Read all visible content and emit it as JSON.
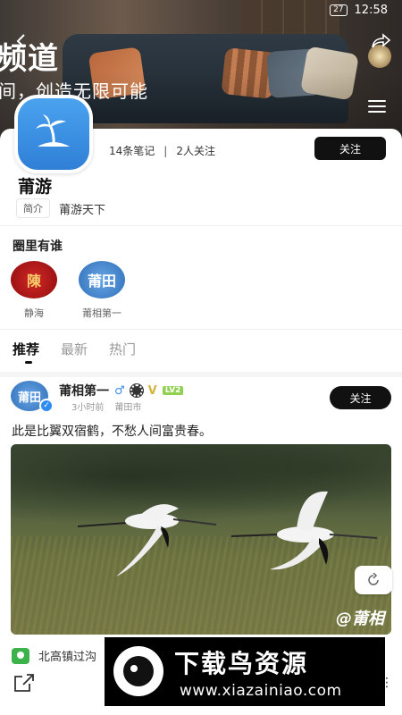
{
  "status_bar": {
    "battery": "27",
    "time": "12:58"
  },
  "banner": {
    "title": "频道",
    "subtitle": "间，创造无限可能"
  },
  "profile": {
    "notes_count": "14条笔记",
    "following_count": "2人关注",
    "follow_label": "关注",
    "name": "莆游",
    "intro_tag": "简介",
    "intro_text": "莆游天下"
  },
  "circle": {
    "title": "圈里有谁",
    "members": [
      {
        "name": "静海",
        "avatar_text": "陳"
      },
      {
        "name": "莆相第一",
        "avatar_text": "莆田"
      }
    ]
  },
  "tabs": [
    {
      "label": "推荐",
      "active": true
    },
    {
      "label": "最新",
      "active": false
    },
    {
      "label": "热门",
      "active": false
    }
  ],
  "post": {
    "avatar_text": "莆田",
    "author": "莆相第一",
    "gender_symbol": "♂",
    "vip_mark": "V",
    "level": "LV2",
    "time": "3小时前",
    "city": "莆田市",
    "follow_label": "关注",
    "text": "此是比翼双宿鹤，不愁人间富贵春。",
    "watermark": "@莆相",
    "location": "北高镇过沟"
  },
  "download_banner": {
    "title": "下载鸟资源",
    "url": "www.xiazainiao.com"
  }
}
